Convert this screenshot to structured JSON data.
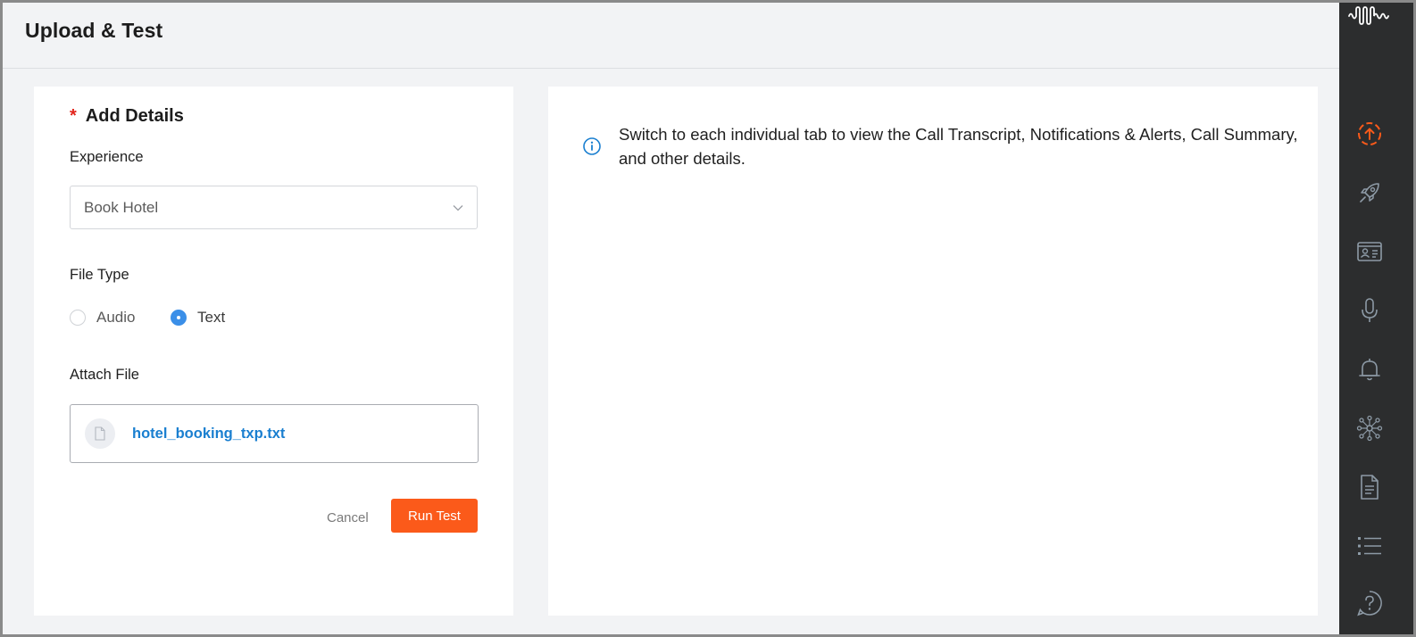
{
  "header": {
    "title": "Upload & Test"
  },
  "form": {
    "required_marker": "*",
    "title": "Add Details",
    "experience_label": "Experience",
    "experience_value": "Book Hotel",
    "file_type_label": "File Type",
    "file_type_options": [
      {
        "label": "Audio",
        "checked": false
      },
      {
        "label": "Text",
        "checked": true
      }
    ],
    "attach_label": "Attach File",
    "attached_file": "hotel_booking_txp.txt",
    "cancel_label": "Cancel",
    "run_label": "Run Test"
  },
  "info": {
    "message": "Switch to each individual tab to view the Call Transcript, Notifications & Alerts, Call Summary, and other details."
  },
  "rail": {
    "logo": "waveform-logo",
    "items": [
      {
        "icon": "upload-circle-icon",
        "active": true
      },
      {
        "icon": "rocket-icon",
        "active": false
      },
      {
        "icon": "id-card-icon",
        "active": false
      },
      {
        "icon": "microphone-icon",
        "active": false
      },
      {
        "icon": "bell-icon",
        "active": false
      },
      {
        "icon": "network-icon",
        "active": false
      },
      {
        "icon": "document-icon",
        "active": false
      },
      {
        "icon": "list-icon",
        "active": false
      },
      {
        "icon": "help-icon",
        "active": false
      }
    ]
  },
  "colors": {
    "accent": "#fb5a1a",
    "link": "#1a7fd0",
    "radio_checked": "#3b8fe8",
    "rail_bg": "#2c2d2e",
    "rail_icon": "#8d9aa6",
    "required": "#e2241b"
  }
}
